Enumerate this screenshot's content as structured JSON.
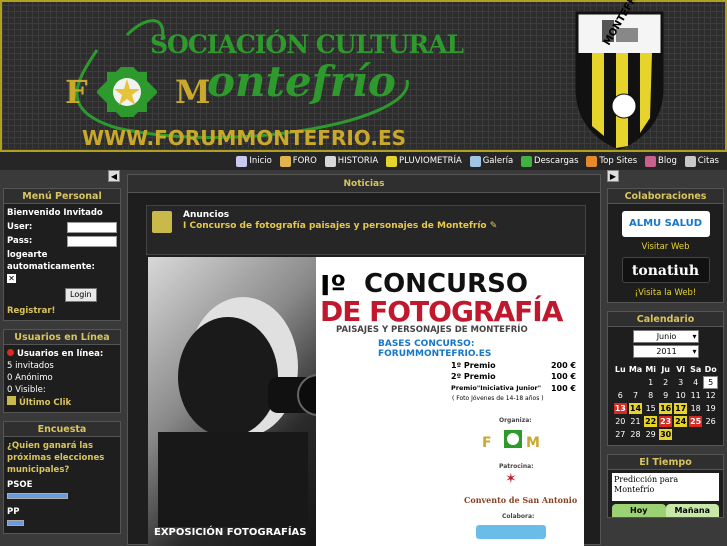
{
  "header": {
    "association": "SOCIACIÓN CULTURAL",
    "fm_f": "F",
    "fm_m": "M",
    "script_name": "ontefrío",
    "url": "WWW.FORUMMONTEFRIO.ES",
    "club": "MONTEFRIO C.F."
  },
  "nav": {
    "items": [
      {
        "label": "Inicio",
        "icon": "home-icon",
        "color": "#c8c8f0"
      },
      {
        "label": "FORO",
        "icon": "forum-icon",
        "color": "#e2b24c"
      },
      {
        "label": "HISTORIA",
        "icon": "history-icon",
        "color": "#d8d8d8"
      },
      {
        "label": "PLUVIOMETRÍA",
        "icon": "rain-icon",
        "color": "#e6d42c"
      },
      {
        "label": "Galería",
        "icon": "gallery-icon",
        "color": "#9fc4e6"
      },
      {
        "label": "Descargas",
        "icon": "download-icon",
        "color": "#44b044"
      },
      {
        "label": "Top Sites",
        "icon": "star-icon",
        "color": "#e48a2c"
      },
      {
        "label": "Blog",
        "icon": "blog-icon",
        "color": "#c86090"
      },
      {
        "label": "Citas",
        "icon": "quote-icon",
        "color": "#c8c8c8"
      }
    ]
  },
  "left": {
    "menu_title": "Menú Personal",
    "welcome": "Bienvenido Invitado",
    "user_label": "User:",
    "pass_label": "Pass:",
    "remember_label": "logearte automaticamente:",
    "login_btn": "Login",
    "register": "Registrar!",
    "online_title": "Usuarios en Línea",
    "online_header": "Usuarios en línea:",
    "guests_n": "5",
    "guests_label": "invitados",
    "anon_n": "0",
    "anon_label": "Anónimo",
    "visible_n": "0",
    "visible_label": "Visible:",
    "last_click": "Último Clik",
    "poll_title": "Encuesta",
    "poll_question": "¿Quien ganará las próximas elecciones municipales?",
    "poll_options": [
      {
        "label": "PSOE",
        "pct": 0.55
      },
      {
        "label": "PP",
        "pct": 0.15
      }
    ]
  },
  "center": {
    "title": "Noticias",
    "announcements": "Anuncios",
    "announcement_link": "I Concurso de fotografía paisajes y personajes de Montefrío",
    "poster": {
      "numeral": "Iº",
      "concurso": "CONCURSO",
      "fotografia": "DE FOTOGRAFÍA",
      "subtitle": "PAISAJES Y PERSONAJES DE MONTEFRÍO",
      "bases": "BASES CONCURSO: FORUMMONTEFRIO.ES",
      "prizes": [
        {
          "label": "1º Premio",
          "value": "200 €"
        },
        {
          "label": "2º Premio",
          "value": "100 €"
        },
        {
          "label": "Premio\"Iniciativa Junior\"",
          "value": "100 €"
        }
      ],
      "age_note": "( Foto Jóvenes de 14-18 años )",
      "organiza": "Organiza:",
      "patrocina": "Patrocina:",
      "convento": "Convento de San Antonio",
      "colabora": "Colabora:",
      "expo": "EXPOSICIÓN FOTOGRAFÍAS"
    }
  },
  "right": {
    "collab_title": "Colaboraciones",
    "collab1_text": "ALMU SALUD",
    "visit1": "Visitar Web",
    "collab2_text": "tonatiuh",
    "visit2": "¡Visita la Web!",
    "cal_title": "Calendario",
    "cal_month": "Junio",
    "cal_year": "2011",
    "days": [
      "Lu",
      "Ma",
      "Mi",
      "Ju",
      "Vi",
      "Sa",
      "Do"
    ],
    "weeks": [
      [
        "",
        "",
        "1",
        "2",
        "3",
        "4",
        "5"
      ],
      [
        "6",
        "7",
        "8",
        "9",
        "10",
        "11",
        "12"
      ],
      [
        "13",
        "14",
        "15",
        "16",
        "17",
        "18",
        "19"
      ],
      [
        "20",
        "21",
        "22",
        "23",
        "24",
        "25",
        "26"
      ],
      [
        "27",
        "28",
        "29",
        "30",
        "",
        "",
        ""
      ]
    ],
    "weather_title": "El Tiempo",
    "weather_text": "Predicción para Montefrío",
    "tab_today": "Hoy",
    "tab_tomorrow": "Mañana"
  }
}
